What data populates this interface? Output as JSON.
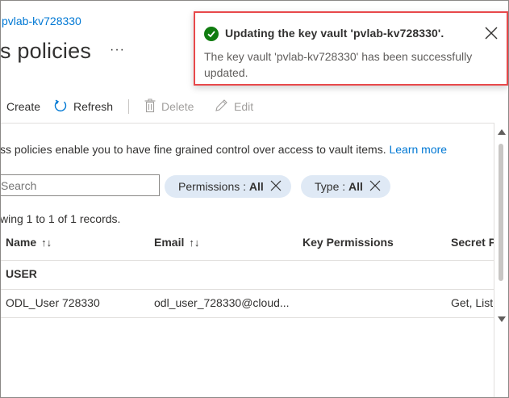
{
  "breadcrumb": "pvlab-kv728330",
  "page_title": "s policies",
  "more_label": "···",
  "toolbar": {
    "create": "Create",
    "refresh": "Refresh",
    "delete": "Delete",
    "edit": "Edit"
  },
  "description": {
    "text": "ss policies enable you to have fine grained control over access to vault items.",
    "link": "Learn more"
  },
  "search": {
    "placeholder": "Search"
  },
  "filters": {
    "permissions": {
      "label": "Permissions : ",
      "value": "All"
    },
    "type": {
      "label": "Type : ",
      "value": "All"
    }
  },
  "records_text": "wing 1 to 1 of 1 records.",
  "table": {
    "columns": [
      "Name",
      "Email",
      "Key Permissions",
      "Secret P"
    ],
    "sort_glyph": "↑↓",
    "group": "USER",
    "rows": [
      {
        "name": "ODL_User 728330",
        "email": "odl_user_728330@cloud...",
        "key_permissions": "",
        "secret_permissions": "Get, List"
      }
    ]
  },
  "toast": {
    "title": "Updating the key vault 'pvlab-kv728330'.",
    "body": "The key vault 'pvlab-kv728330' has been successfully updated.",
    "status_color": "#107c10",
    "highlight_color": "#e8494b"
  },
  "colors": {
    "link": "#0078d4",
    "pill": "#dfe9f5"
  }
}
